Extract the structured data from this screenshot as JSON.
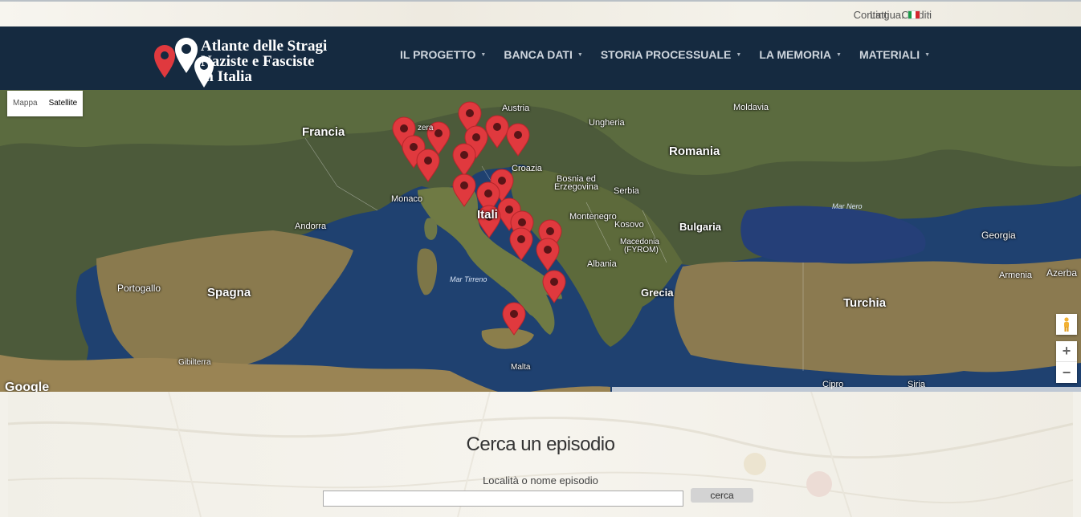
{
  "topbar": {
    "contacts": "Contatti",
    "credits": "Crediti",
    "language_label": "Lingua:",
    "language_flag": "it-flag-icon"
  },
  "brand": {
    "title_line1": "Atlante delle Stragi",
    "title_line2": "Naziste e Fasciste",
    "title_line3": "in Italia"
  },
  "nav": {
    "items": [
      {
        "label": "IL PROGETTO"
      },
      {
        "label": "BANCA DATI"
      },
      {
        "label": "STORIA PROCESSUALE"
      },
      {
        "label": "LA MEMORIA"
      },
      {
        "label": "MATERIALI"
      }
    ]
  },
  "map": {
    "type_buttons": {
      "map": "Mappa",
      "satellite": "Satellite"
    },
    "labels": {
      "francia": "Francia",
      "austria": "Austria",
      "ungheria": "Ungheria",
      "moldavia": "Moldavia",
      "romania": "Romania",
      "croazia": "Croazia",
      "bosnia": "Bosnia ed",
      "erzegovina": "Erzegovina",
      "serbia": "Serbia",
      "monaco": "Monaco",
      "andorra": "Andorra",
      "montenegro": "Montenegro",
      "kosovo": "Kosovo",
      "bulgaria": "Bulgaria",
      "macedonia": "Macedonia",
      "fyrom": "(FYROM)",
      "albania": "Albania",
      "portogallo": "Portogallo",
      "spagna": "Spagna",
      "mar_tirreno": "Mar Tirreno",
      "grecia": "Grecia",
      "turchia": "Turchia",
      "mar_nero": "Mar Nero",
      "georgia": "Georgia",
      "armenia": "Armenia",
      "azerba": "Azerba",
      "gibilterra": "Gibilterra",
      "malta": "Malta",
      "siria": "Siria",
      "cipro": "Cipro",
      "svizzera": "zera",
      "italia": "Itali"
    },
    "zoom_in": "+",
    "zoom_out": "−",
    "logo": "Google",
    "marker_color": "#e0393e"
  },
  "search": {
    "heading": "Cerca un episodio",
    "field_label": "Località o nome episodio",
    "input_value": "",
    "button_label": "cerca"
  }
}
